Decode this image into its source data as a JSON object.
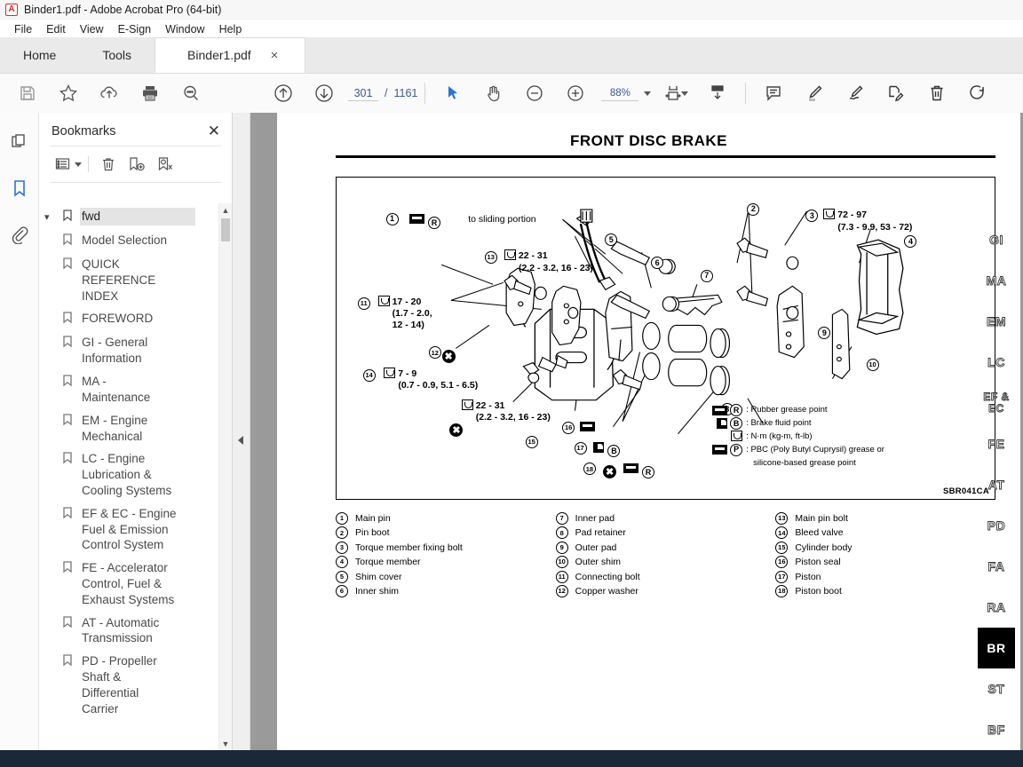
{
  "window": {
    "title": "Binder1.pdf - Adobe Acrobat Pro (64-bit)",
    "logo_icon": "acrobat-logo-icon"
  },
  "menu": {
    "items": [
      "File",
      "Edit",
      "View",
      "E-Sign",
      "Window",
      "Help"
    ]
  },
  "tabs": {
    "home": "Home",
    "tools": "Tools",
    "document": "Binder1.pdf",
    "close": "×"
  },
  "toolbar": {
    "icons": [
      "save-icon",
      "star-icon",
      "cloud-upload-icon",
      "print-icon",
      "search-icon",
      "previous-page-icon",
      "next-page-icon"
    ],
    "page_current": "301",
    "page_separator": "/",
    "page_total": "1161",
    "select_tool": "select-cursor-icon",
    "hand_tool": "hand-icon",
    "zoom_out": "zoom-out-icon",
    "zoom_in": "zoom-in-icon",
    "zoom_value": "88%",
    "fit_page_icon": "fit-page-icon",
    "scroll_mode_icon": "scroll-mode-icon",
    "comment_icon": "comment-icon",
    "highlight_icon": "highlight-icon",
    "sign_icon": "sign-icon",
    "fill_sign_icon": "fill-and-sign-icon",
    "delete_icon": "trash-icon",
    "rotate_icon": "rotate-icon"
  },
  "rail": {
    "items": [
      "page-thumbnails-icon",
      "bookmarks-icon",
      "attachments-icon"
    ],
    "selected": "bookmarks-icon"
  },
  "bookmarks": {
    "title": "Bookmarks",
    "close_label": "✕",
    "tools": [
      "options-list-icon",
      "delete-bookmark-icon",
      "new-bookmark-icon",
      "find-bookmark-icon"
    ],
    "root": {
      "label": "fwd",
      "expanded": true
    },
    "items": [
      {
        "label": "Model Selection"
      },
      {
        "label": "QUICK REFERENCE INDEX"
      },
      {
        "label": "FOREWORD"
      },
      {
        "label": "GI - General Information"
      },
      {
        "label": "MA - Maintenance"
      },
      {
        "label": "EM - Engine Mechanical"
      },
      {
        "label": "LC - Engine Lubrication & Cooling Systems"
      },
      {
        "label": "EF & EC - Engine Fuel & Emission Control System"
      },
      {
        "label": "FE - Accelerator Control, Fuel & Exhaust Systems"
      },
      {
        "label": "AT - Automatic Transmission"
      },
      {
        "label": "PD - Propeller Shaft & Differential Carrier"
      }
    ]
  },
  "document": {
    "title": "FRONT DISC BRAKE",
    "figure_code": "SBR041CA",
    "callouts": {
      "c1": "1",
      "c2": "2",
      "c3": "3",
      "c4": "4",
      "c5": "5",
      "c6": "6",
      "c7": "7",
      "c8": "8",
      "c9": "9",
      "c10": "10",
      "c11": "11",
      "c12": "12",
      "c13": "13",
      "c14": "14",
      "c15": "15",
      "c16": "16",
      "c17": "17",
      "c18": "18"
    },
    "annotations": {
      "sliding_portion": "to sliding portion",
      "torque_3_line1": "72 - 97",
      "torque_3_line2": "(7.3 - 9.9, 53 - 72)",
      "torque_13_line1": "22 - 31",
      "torque_13_line2": "(2.2 - 3.2, 16 - 23)",
      "torque_11_line1": "17 - 20",
      "torque_11_line2": "(1.7 - 2.0,",
      "torque_11_line3": "12 - 14)",
      "torque_14_line1": "7 - 9",
      "torque_14_line2": "(0.7 - 0.9, 5.1 - 6.5)",
      "torque_mid_line1": "22 - 31",
      "torque_mid_line2": "(2.2 - 3.2, 16 - 23)"
    },
    "legend": [
      {
        "glyph": "grease-bar-icon",
        "badge": "R",
        "text": ": Rubber grease point"
      },
      {
        "glyph": "fluid-drop-icon",
        "badge": "B",
        "text": ": Brake fluid point"
      },
      {
        "glyph": "torque-wrench-icon",
        "badge": "",
        "text": ": N·m (kg-m, ft-lb)"
      },
      {
        "glyph": "grease-bar-icon",
        "badge": "P",
        "text": ": PBC (Poly Butyl Cuprysil) grease or"
      },
      {
        "glyph": "",
        "badge": "",
        "text": "   silicone-based grease point"
      }
    ],
    "parts_columns": [
      [
        {
          "num": "1",
          "name": "Main pin"
        },
        {
          "num": "2",
          "name": "Pin boot"
        },
        {
          "num": "3",
          "name": "Torque member fixing bolt"
        },
        {
          "num": "4",
          "name": "Torque member"
        },
        {
          "num": "5",
          "name": "Shim cover"
        },
        {
          "num": "6",
          "name": "Inner shim"
        }
      ],
      [
        {
          "num": "7",
          "name": "Inner pad"
        },
        {
          "num": "8",
          "name": "Pad retainer"
        },
        {
          "num": "9",
          "name": "Outer pad"
        },
        {
          "num": "10",
          "name": "Outer shim"
        },
        {
          "num": "11",
          "name": "Connecting bolt"
        },
        {
          "num": "12",
          "name": "Copper washer"
        }
      ],
      [
        {
          "num": "13",
          "name": "Main pin bolt"
        },
        {
          "num": "14",
          "name": "Bleed valve"
        },
        {
          "num": "15",
          "name": "Cylinder body"
        },
        {
          "num": "16",
          "name": "Piston seal"
        },
        {
          "num": "17",
          "name": "Piston"
        },
        {
          "num": "18",
          "name": "Piston boot"
        }
      ]
    ],
    "index_tabs": [
      {
        "label": "GI",
        "active": false
      },
      {
        "label": "MA",
        "active": false
      },
      {
        "label": "EM",
        "active": false
      },
      {
        "label": "LC",
        "active": false
      },
      {
        "label": "EF &\nEC",
        "active": false
      },
      {
        "label": "FE",
        "active": false
      },
      {
        "label": "AT",
        "active": false
      },
      {
        "label": "PD",
        "active": false
      },
      {
        "label": "FA",
        "active": false
      },
      {
        "label": "RA",
        "active": false
      },
      {
        "label": "BR",
        "active": true
      },
      {
        "label": "ST",
        "active": false
      },
      {
        "label": "BF",
        "active": false
      }
    ]
  },
  "colors": {
    "accent": "#2a74d4",
    "link": "#3a5a8c",
    "taskbar": "#1b2838",
    "viewer_bg": "#9a9a9a"
  }
}
